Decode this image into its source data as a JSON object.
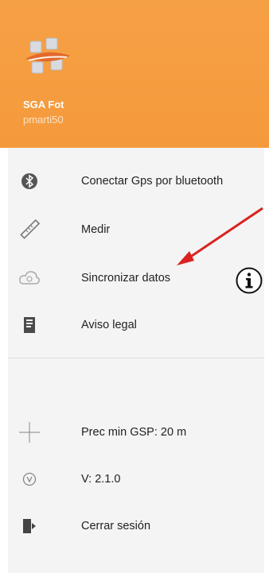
{
  "header": {
    "app_name": "SGA Fot",
    "user": "pmarti50",
    "color": "#f59a3c"
  },
  "menu": {
    "items": [
      {
        "label": "Conectar Gps por bluetooth",
        "icon": "bluetooth-icon"
      },
      {
        "label": "Medir",
        "icon": "ruler-icon"
      },
      {
        "label": "Sincronizar datos",
        "icon": "cloud-sync-icon"
      },
      {
        "label": "Aviso legal",
        "icon": "legal-document-icon"
      }
    ],
    "footer_items": [
      {
        "label": "Prec min GSP: 20 m",
        "icon": "crosshair-icon"
      },
      {
        "label": "V: 2.1.0",
        "icon": "version-icon"
      },
      {
        "label": "Cerrar sesión",
        "icon": "logout-icon"
      }
    ]
  },
  "annotation": {
    "arrow_color": "#d9231f",
    "info_icon": "info-icon"
  }
}
